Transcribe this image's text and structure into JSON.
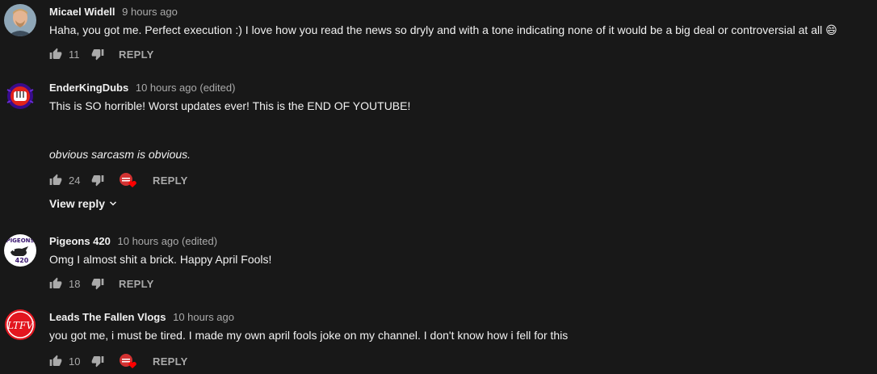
{
  "comments": [
    {
      "author": "Micael Widell",
      "time": "9 hours ago",
      "text": "Haha, you got me. Perfect execution :) I love how you read the news so dryly and with a tone indicating none of it would be a big deal or controversial at all",
      "emoji": "😄",
      "likes": "11",
      "reply_label": "REPLY",
      "avatar_icon": "person-photo-avatar"
    },
    {
      "author": "EnderKingDubs",
      "time": "10 hours ago (edited)",
      "text": "This is SO horrible! Worst updates ever! This is the END OF YOUTUBE!",
      "text2": "obvious sarcasm is obvious.",
      "likes": "24",
      "reply_label": "REPLY",
      "view_reply_label": "View reply",
      "creator_heart": true,
      "avatar_icon": "fist-logo-avatar"
    },
    {
      "author": "Pigeons 420",
      "time": "10 hours ago (edited)",
      "text": "Omg I almost shit a brick. Happy April Fools!",
      "likes": "18",
      "reply_label": "REPLY",
      "avatar_icon": "pigeon-logo-avatar",
      "avatar_text_top": "PIGEONS",
      "avatar_text_bottom": "420"
    },
    {
      "author": "Leads The Fallen Vlogs",
      "time": "10 hours ago",
      "text": "you got me, i must be tired. I made my own april fools joke on my channel. I don't know how i fell for this",
      "likes": "10",
      "reply_label": "REPLY",
      "creator_heart": true,
      "avatar_icon": "ltfv-logo-avatar",
      "avatar_text": "LTFV"
    }
  ],
  "colors": {
    "background": "#181818",
    "text": "#f1f1f1",
    "secondary": "#aaaaaa",
    "heart": "#ff0000"
  }
}
